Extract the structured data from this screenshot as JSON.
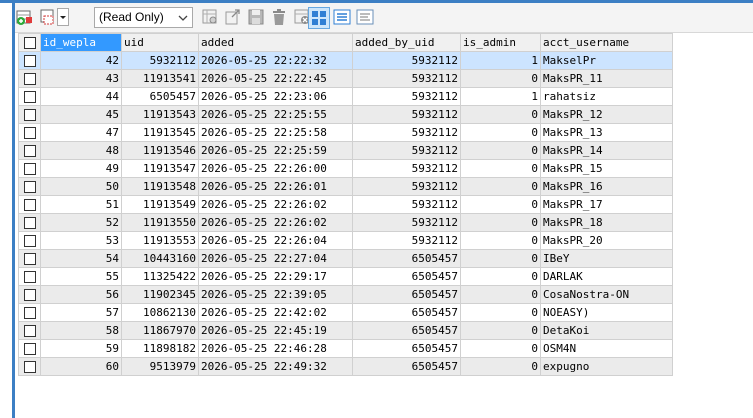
{
  "toolbar": {
    "mode_select": "(Read Only)"
  },
  "table": {
    "columns": [
      "id_wepla",
      "uid",
      "added",
      "added_by_uid",
      "is_admin",
      "acct_username"
    ],
    "rows": [
      [
        "42",
        "5932112",
        "2026-05-25 22:22:32",
        "5932112",
        "1",
        "MakselPr"
      ],
      [
        "43",
        "11913541",
        "2026-05-25 22:22:45",
        "5932112",
        "0",
        "MaksPR_11"
      ],
      [
        "44",
        "6505457",
        "2026-05-25 22:23:06",
        "5932112",
        "1",
        "rahatsiz"
      ],
      [
        "45",
        "11913543",
        "2026-05-25 22:25:55",
        "5932112",
        "0",
        "MaksPR_12"
      ],
      [
        "47",
        "11913545",
        "2026-05-25 22:25:58",
        "5932112",
        "0",
        "MaksPR_13"
      ],
      [
        "48",
        "11913546",
        "2026-05-25 22:25:59",
        "5932112",
        "0",
        "MaksPR_14"
      ],
      [
        "49",
        "11913547",
        "2026-05-25 22:26:00",
        "5932112",
        "0",
        "MaksPR_15"
      ],
      [
        "50",
        "11913548",
        "2026-05-25 22:26:01",
        "5932112",
        "0",
        "MaksPR_16"
      ],
      [
        "51",
        "11913549",
        "2026-05-25 22:26:02",
        "5932112",
        "0",
        "MaksPR_17"
      ],
      [
        "52",
        "11913550",
        "2026-05-25 22:26:02",
        "5932112",
        "0",
        "MaksPR_18"
      ],
      [
        "53",
        "11913553",
        "2026-05-25 22:26:04",
        "5932112",
        "0",
        "MaksPR_20"
      ],
      [
        "54",
        "10443160",
        "2026-05-25 22:27:04",
        "6505457",
        "0",
        "IBeY"
      ],
      [
        "55",
        "11325422",
        "2026-05-25 22:29:17",
        "6505457",
        "0",
        "DARLAK"
      ],
      [
        "56",
        "11902345",
        "2026-05-25 22:39:05",
        "6505457",
        "0",
        "CosaNostra-ON"
      ],
      [
        "57",
        "10862130",
        "2026-05-25 22:42:02",
        "6505457",
        "0",
        "NOEASY)"
      ],
      [
        "58",
        "11867970",
        "2026-05-25 22:45:19",
        "6505457",
        "0",
        "DetaKoi"
      ],
      [
        "59",
        "11898182",
        "2026-05-25 22:46:28",
        "6505457",
        "0",
        "OSM4N"
      ],
      [
        "60",
        "9513979",
        "2026-05-25 22:49:32",
        "6505457",
        "0",
        "expugno"
      ]
    ]
  }
}
